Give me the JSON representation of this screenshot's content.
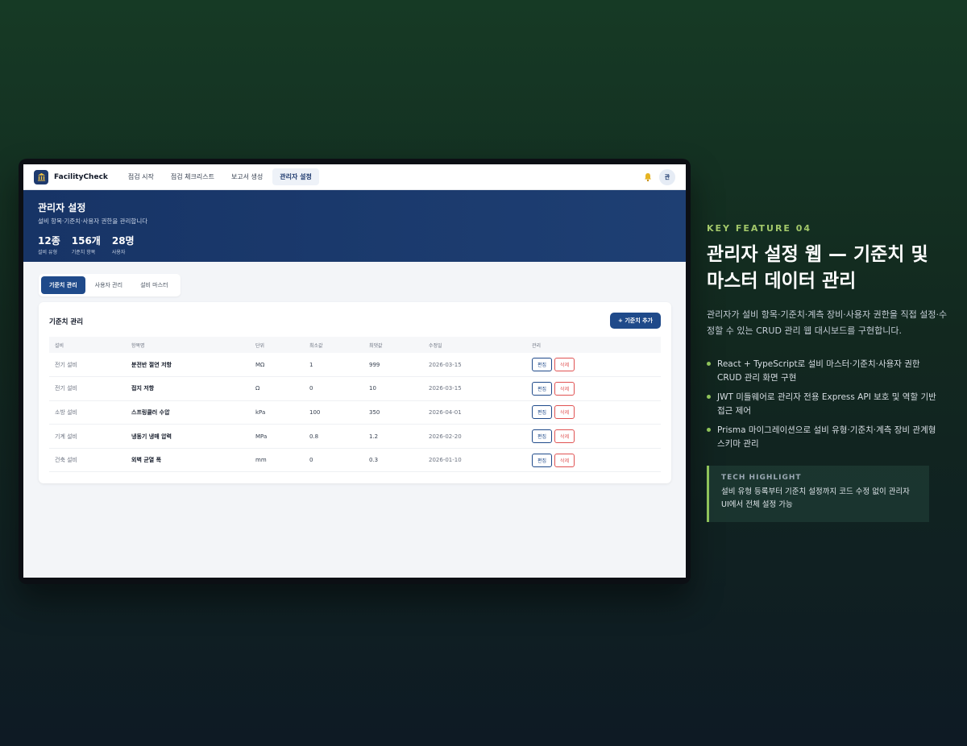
{
  "app": {
    "brand": "FacilityCheck",
    "nav": [
      "점검 시작",
      "점검 체크리스트",
      "보고서 생성",
      "관리자 설정"
    ],
    "avatar": "관"
  },
  "hero": {
    "title": "관리자 설정",
    "subtitle": "설비 항목·기준치·사용자 권한을 관리합니다",
    "stats": [
      {
        "value": "12종",
        "label": "설비 유형"
      },
      {
        "value": "156개",
        "label": "기준치 항목"
      },
      {
        "value": "28명",
        "label": "사용자"
      }
    ]
  },
  "tabs": [
    "기준치 관리",
    "사용자 관리",
    "설비 마스터"
  ],
  "card": {
    "title": "기준치 관리",
    "add_button": "+ 기준치 추가",
    "columns": [
      "설비",
      "항목명",
      "단위",
      "최소값",
      "최댓값",
      "수정일",
      "관리"
    ],
    "rows": [
      {
        "equipment": "전기 설비",
        "item": "분전반 절연 저항",
        "unit": "MΩ",
        "min": "1",
        "max": "999",
        "date": "2026-03-15"
      },
      {
        "equipment": "전기 설비",
        "item": "접지 저항",
        "unit": "Ω",
        "min": "0",
        "max": "10",
        "date": "2026-03-15"
      },
      {
        "equipment": "소방 설비",
        "item": "스프링클러 수압",
        "unit": "kPa",
        "min": "100",
        "max": "350",
        "date": "2026-04-01"
      },
      {
        "equipment": "기계 설비",
        "item": "냉동기 냉매 압력",
        "unit": "MPa",
        "min": "0.8",
        "max": "1.2",
        "date": "2026-02-20"
      },
      {
        "equipment": "건축 설비",
        "item": "외벽 균열 폭",
        "unit": "mm",
        "min": "0",
        "max": "0.3",
        "date": "2026-01-10"
      }
    ],
    "edit_label": "편집",
    "delete_label": "삭제"
  },
  "panel": {
    "kicker": "KEY FEATURE 04",
    "headline": "관리자 설정 웹 — 기준치 및 마스터 데이터 관리",
    "description": "관리자가 설비 항목·기준치·계측 장비·사용자 권한을 직접 설정·수정할 수 있는 CRUD 관리 웹 대시보드를 구현합니다.",
    "bullets": [
      "React + TypeScript로 설비 마스터·기준치·사용자 권한 CRUD 관리 화면 구현",
      "JWT 미들웨어로 관리자 전용 Express API 보호 및 역할 기반 접근 제어",
      "Prisma 마이그레이션으로 설비 유형·기준치·계측 장비 관계형 스키마 관리"
    ],
    "highlight_title": "TECH HIGHLIGHT",
    "highlight_body": "설비 유형 등록부터 기준치 설정까지 코드 수정 없이 관리자 UI에서 전체 설정 가능"
  },
  "colors": {
    "accent": "#1f4a8a",
    "brand_green": "#8fc35a",
    "danger": "#e05252"
  }
}
